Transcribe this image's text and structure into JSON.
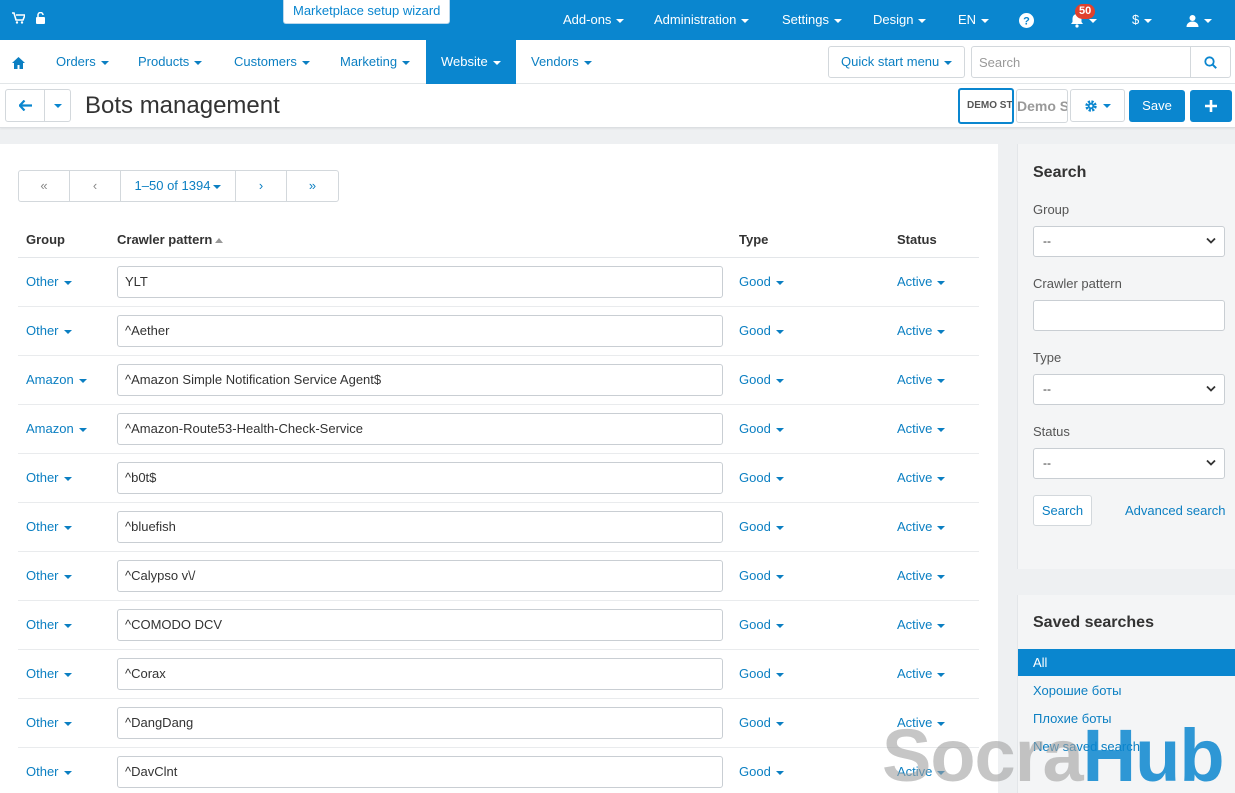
{
  "topbar": {
    "wizard_label": "Marketplace setup wizard",
    "addons": "Add-ons",
    "administration": "Administration",
    "settings": "Settings",
    "design": "Design",
    "language": "EN",
    "notifications_count": "50",
    "currency": "$"
  },
  "nav": {
    "orders": "Orders",
    "products": "Products",
    "customers": "Customers",
    "marketing": "Marketing",
    "website": "Website",
    "vendors": "Vendors",
    "quick_start": "Quick start menu",
    "search_placeholder": "Search"
  },
  "titlebar": {
    "title": "Bots management",
    "demo_store_1": "DEMO STORE",
    "demo_store_2": "Demo Store",
    "save_label": "Save"
  },
  "pagination": {
    "first": "«",
    "prev": "‹",
    "range": "1–50 of 1394",
    "next": "›",
    "last": "»"
  },
  "table": {
    "headers": {
      "group": "Group",
      "pattern": "Crawler pattern",
      "type": "Type",
      "status": "Status"
    },
    "rows": [
      {
        "group": "Other",
        "pattern": "YLT",
        "type": "Good",
        "status": "Active"
      },
      {
        "group": "Other",
        "pattern": "^Aether",
        "type": "Good",
        "status": "Active"
      },
      {
        "group": "Amazon",
        "pattern": "^Amazon Simple Notification Service Agent$",
        "type": "Good",
        "status": "Active"
      },
      {
        "group": "Amazon",
        "pattern": "^Amazon-Route53-Health-Check-Service",
        "type": "Good",
        "status": "Active"
      },
      {
        "group": "Other",
        "pattern": "^b0t$",
        "type": "Good",
        "status": "Active"
      },
      {
        "group": "Other",
        "pattern": "^bluefish",
        "type": "Good",
        "status": "Active"
      },
      {
        "group": "Other",
        "pattern": "^Calypso v\\/",
        "type": "Good",
        "status": "Active"
      },
      {
        "group": "Other",
        "pattern": "^COMODO DCV",
        "type": "Good",
        "status": "Active"
      },
      {
        "group": "Other",
        "pattern": "^Corax",
        "type": "Good",
        "status": "Active"
      },
      {
        "group": "Other",
        "pattern": "^DangDang",
        "type": "Good",
        "status": "Active"
      },
      {
        "group": "Other",
        "pattern": "^DavClnt",
        "type": "Good",
        "status": "Active"
      }
    ]
  },
  "sidebar": {
    "title": "Search",
    "group_label": "Group",
    "group_value": "--",
    "pattern_label": "Crawler pattern",
    "type_label": "Type",
    "type_value": "--",
    "status_label": "Status",
    "status_value": "--",
    "search_button": "Search",
    "advanced_link": "Advanced search"
  },
  "saved": {
    "title": "Saved searches",
    "all": "All",
    "items": [
      "Хорошие боты",
      "Плохие боты",
      "New saved search"
    ]
  },
  "watermark": {
    "part1": "Socra",
    "part2": "Hub"
  },
  "colors": {
    "brand": "#0a86cf",
    "link": "#0b7fc2",
    "badge": "#e0412d"
  }
}
